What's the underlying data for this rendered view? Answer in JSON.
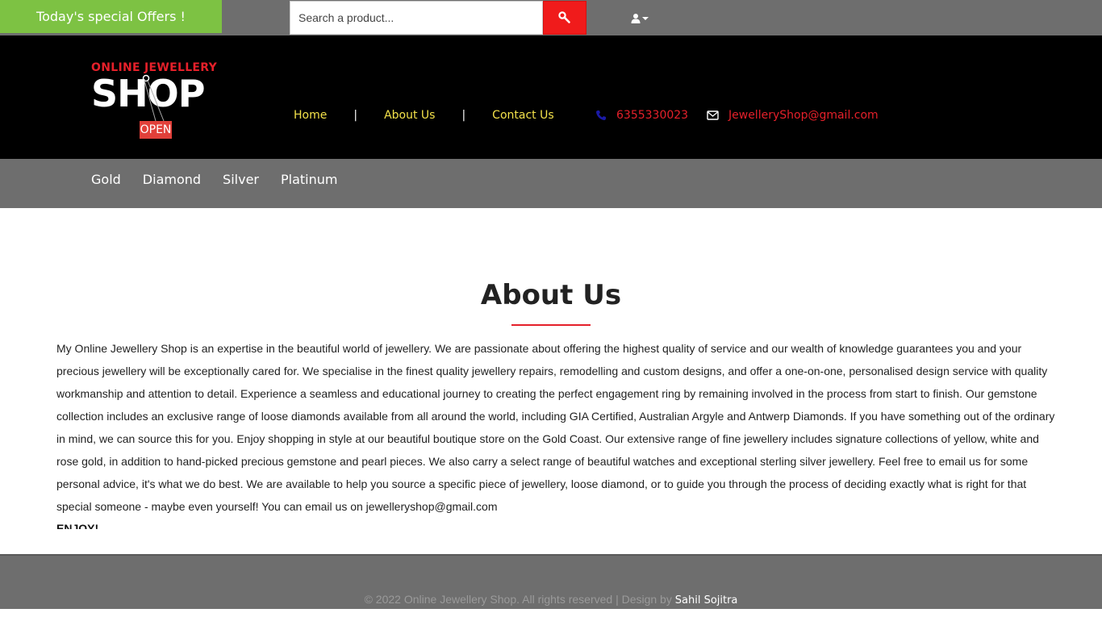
{
  "topbar": {
    "offers_label": "Today's special Offers !",
    "search_placeholder": "Search a product...",
    "search_value": "",
    "user_icon": "user-icon"
  },
  "header": {
    "logo": {
      "line1": "ONLINE JEWELLERY",
      "line2": "SHOP",
      "sign": "OPEN"
    },
    "nav": [
      {
        "label": "Home"
      },
      {
        "label": "About Us"
      },
      {
        "label": "Contact Us"
      }
    ],
    "nav_separator": "|",
    "phone": "6355330023",
    "email": "JewelleryShop@gmail.com"
  },
  "categories": [
    {
      "label": "Gold"
    },
    {
      "label": "Diamond"
    },
    {
      "label": "Silver"
    },
    {
      "label": "Platinum"
    }
  ],
  "about": {
    "title": "About Us",
    "body": "My Online Jewellery Shop is an expertise in the beautiful world of jewellery. We are passionate about offering the highest quality of service and our wealth of knowledge guarantees you and your precious jewellery will be exceptionally cared for. We specialise in the finest quality jewellery repairs, remodelling and custom designs, and offer a one-on-one, personalised design service with quality workmanship and attention to detail. Experience a seamless and educational journey to creating the perfect engagement ring by remaining involved in the process from start to finish. Our gemstone collection includes an exclusive range of loose diamonds available from all around the world, including GIA Certified, Australian Argyle and Antwerp Diamonds. If you have something out of the ordinary in mind, we can source this for you. Enjoy shopping in style at our beautiful boutique store on the Gold Coast. Our extensive range of fine jewellery includes signature collections of yellow, white and rose gold, in addition to hand-picked precious gemstone and pearl pieces. We also carry a select range of beautiful watches and exceptional sterling silver jewellery. Feel free to email us for some personal advice, it's what we do best. We are available to help you source a specific piece of jewellery, loose diamond, or to guide you through the process of deciding exactly what is right for that special someone - maybe even yourself! You can email us on jewelleryshop@gmail.com",
    "closing": "ENJOY!"
  },
  "footer": {
    "copyright": "© 2022 Online Jewellery Shop. All rights reserved | Design by",
    "author": "Sahil Sojitra"
  },
  "colors": {
    "topbar_bg": "#6e6e6e",
    "offers_bg": "#7dc243",
    "search_button": "#f01b1b",
    "header_bg": "#000000",
    "nav_link": "#f3e14a",
    "accent_red": "#e5202a"
  }
}
